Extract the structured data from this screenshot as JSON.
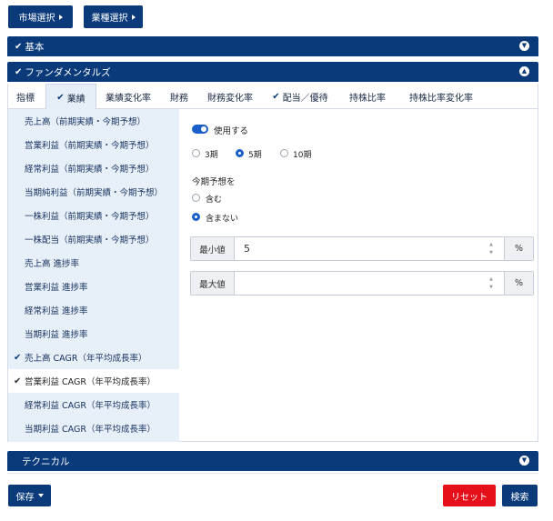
{
  "top_buttons": {
    "market": "市場選択",
    "industry": "業種選択"
  },
  "sections": {
    "basic": {
      "label": "基本",
      "checked": true
    },
    "fundamentals": {
      "label": "ファンダメンタルズ",
      "checked": true
    },
    "technical": {
      "label": "テクニカル",
      "checked": false
    }
  },
  "tabs": [
    {
      "label": "指標",
      "checked": false,
      "active": false
    },
    {
      "label": "業績",
      "checked": true,
      "active": true
    },
    {
      "label": "業績変化率",
      "checked": false,
      "active": false
    },
    {
      "label": "財務",
      "checked": false,
      "active": false
    },
    {
      "label": "財務変化率",
      "checked": false,
      "active": false
    },
    {
      "label": "配当／優待",
      "checked": true,
      "active": false
    },
    {
      "label": "持株比率",
      "checked": false,
      "active": false
    },
    {
      "label": "持株比率変化率",
      "checked": false,
      "active": false
    }
  ],
  "side_items": [
    {
      "label": "売上高（前期実績・今期予想）",
      "checked": false,
      "active": false
    },
    {
      "label": "営業利益（前期実績・今期予想）",
      "checked": false,
      "active": false
    },
    {
      "label": "経常利益（前期実績・今期予想）",
      "checked": false,
      "active": false
    },
    {
      "label": "当期純利益（前期実績・今期予想）",
      "checked": false,
      "active": false
    },
    {
      "label": "一株利益（前期実績・今期予想）",
      "checked": false,
      "active": false
    },
    {
      "label": "一株配当（前期実績・今期予想）",
      "checked": false,
      "active": false
    },
    {
      "label": "売上高  進捗率",
      "checked": false,
      "active": false
    },
    {
      "label": "営業利益  進捗率",
      "checked": false,
      "active": false
    },
    {
      "label": "経常利益  進捗率",
      "checked": false,
      "active": false
    },
    {
      "label": "当期利益  進捗率",
      "checked": false,
      "active": false
    },
    {
      "label": "売上高  CAGR（年平均成長率）",
      "checked": true,
      "active": false
    },
    {
      "label": "営業利益  CAGR（年平均成長率）",
      "checked": true,
      "active": true
    },
    {
      "label": "経常利益  CAGR（年平均成長率）",
      "checked": false,
      "active": false
    },
    {
      "label": "当期利益  CAGR（年平均成長率）",
      "checked": false,
      "active": false
    }
  ],
  "form": {
    "use_label": "使用する",
    "use_enabled": true,
    "period_options": [
      "3期",
      "5期",
      "10期"
    ],
    "period_selected": "5期",
    "forecast_heading": "今期予想を",
    "forecast_options": [
      "含む",
      "含まない"
    ],
    "forecast_selected": "含まない",
    "min": {
      "label": "最小値",
      "value": "5",
      "unit": "%"
    },
    "max": {
      "label": "最大値",
      "value": "",
      "unit": "%"
    }
  },
  "footer": {
    "save": "保存",
    "reset": "リセット",
    "search": "検索"
  },
  "colors": {
    "navy": "#0b3a7a",
    "accent_blue": "#1a5ec9",
    "reset_red": "#e6101a",
    "side_bg": "#e7eff9"
  }
}
